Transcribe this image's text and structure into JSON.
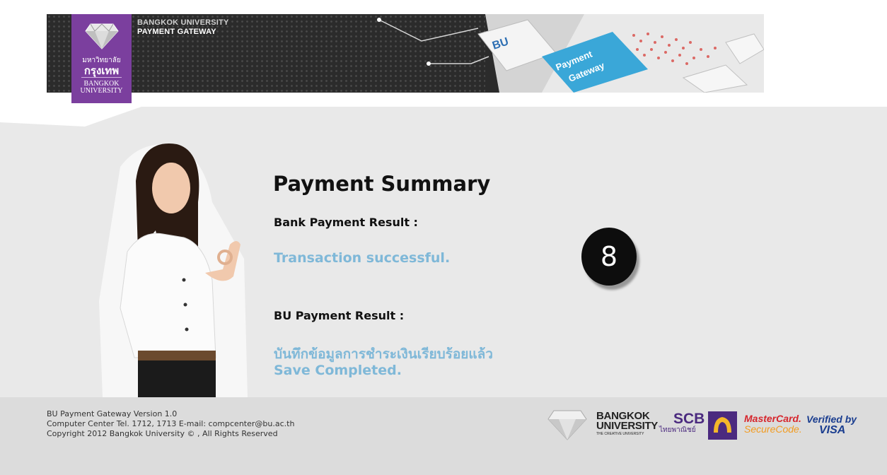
{
  "header": {
    "banner_title_line1": "BANGKOK UNIVERSITY",
    "banner_title_line2": "PAYMENT GATEWAY",
    "logo_thai_line1": "มหาวิทยาลัย",
    "logo_thai_line2": "กรุงเทพ",
    "logo_en_line1": "BANGKOK",
    "logo_en_line2": "UNIVERSITY",
    "key_label_bu": "BU",
    "key_label_payment": "Payment",
    "key_label_gateway": "Gateway"
  },
  "summary": {
    "title": "Payment Summary",
    "bank_label": "Bank Payment Result :",
    "bank_result": "Transaction successful.",
    "bu_label": "BU Payment Result :",
    "bu_result_thai": "บันทึกข้อมูลการชำระเงินเรียบร้อยแล้ว",
    "bu_result_en": "Save Completed."
  },
  "step_badge": "8",
  "footer": {
    "line1": "BU Payment Gateway Version 1.0",
    "line2": "Computer Center Tel. 1712, 1713 E-mail: compcenter@bu.ac.th",
    "line3": "Copyright 2012 Bangkok University © , All Rights Reserved"
  },
  "partners": {
    "bu_line1": "BANGKOK",
    "bu_line2": "UNIVERSITY",
    "bu_tagline": "THE CREATIVE UNIVERSITY",
    "scb_name": "SCB",
    "scb_thai": "ไทยพาณิชย์",
    "mastercard_line1": "MasterCard.",
    "mastercard_line2": "SecureCode.",
    "visa_line1": "Verified by",
    "visa_line2": "VISA"
  },
  "colors": {
    "purple": "#7b3f9e",
    "result_blue": "#7fb8d8",
    "scb_purple": "#4b2a7f",
    "scb_yellow": "#f4b72a"
  }
}
